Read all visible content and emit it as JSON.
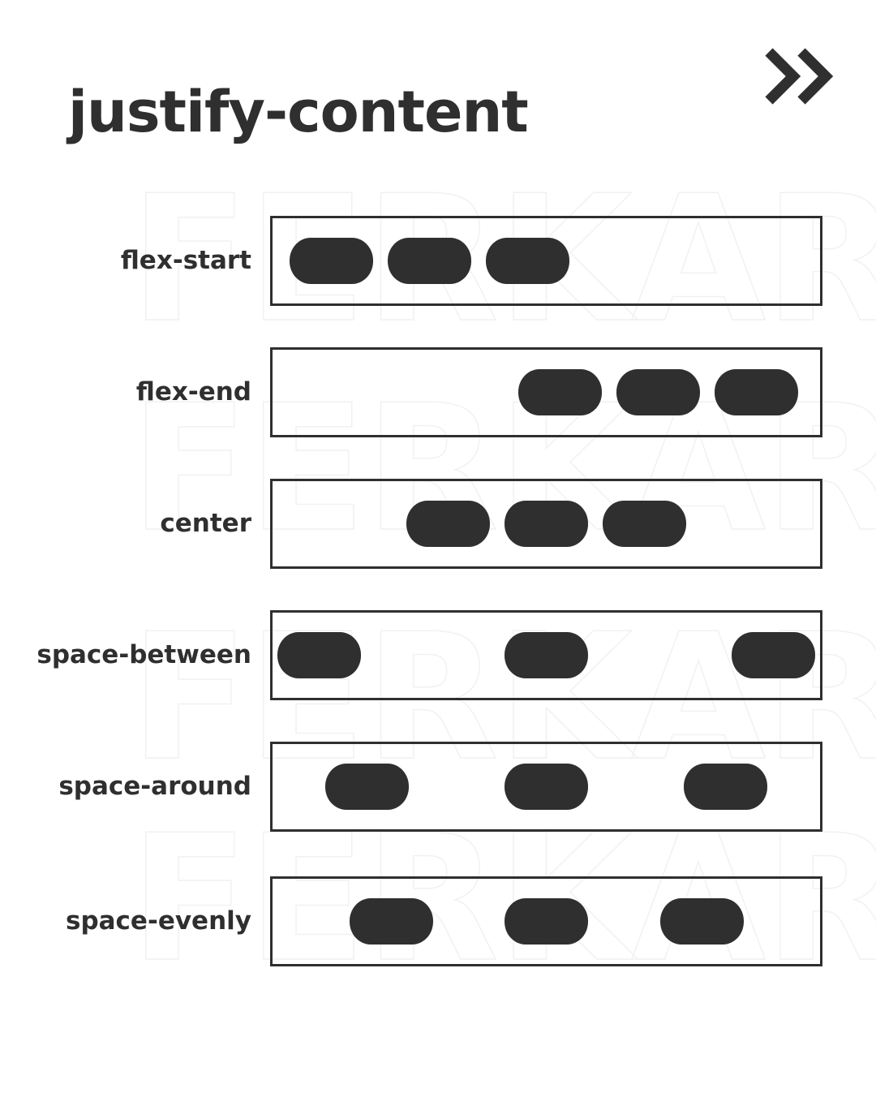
{
  "title": "justify-content",
  "watermark": "FERKAR",
  "icons": {
    "next": "double-chevron-right-icon"
  },
  "colors": {
    "ink": "#2f2f2f",
    "background": "#ffffff",
    "watermark": "#f1f1f1"
  },
  "rows": [
    {
      "label": "flex-start",
      "value": "flex-start",
      "items": 3
    },
    {
      "label": "flex-end",
      "value": "flex-end",
      "items": 3
    },
    {
      "label": "center",
      "value": "center",
      "items": 3
    },
    {
      "label": "space-between",
      "value": "space-between",
      "items": 3
    },
    {
      "label": "space-around",
      "value": "space-around",
      "items": 3
    },
    {
      "label": "space-evenly",
      "value": "space-evenly",
      "items": 3
    }
  ]
}
